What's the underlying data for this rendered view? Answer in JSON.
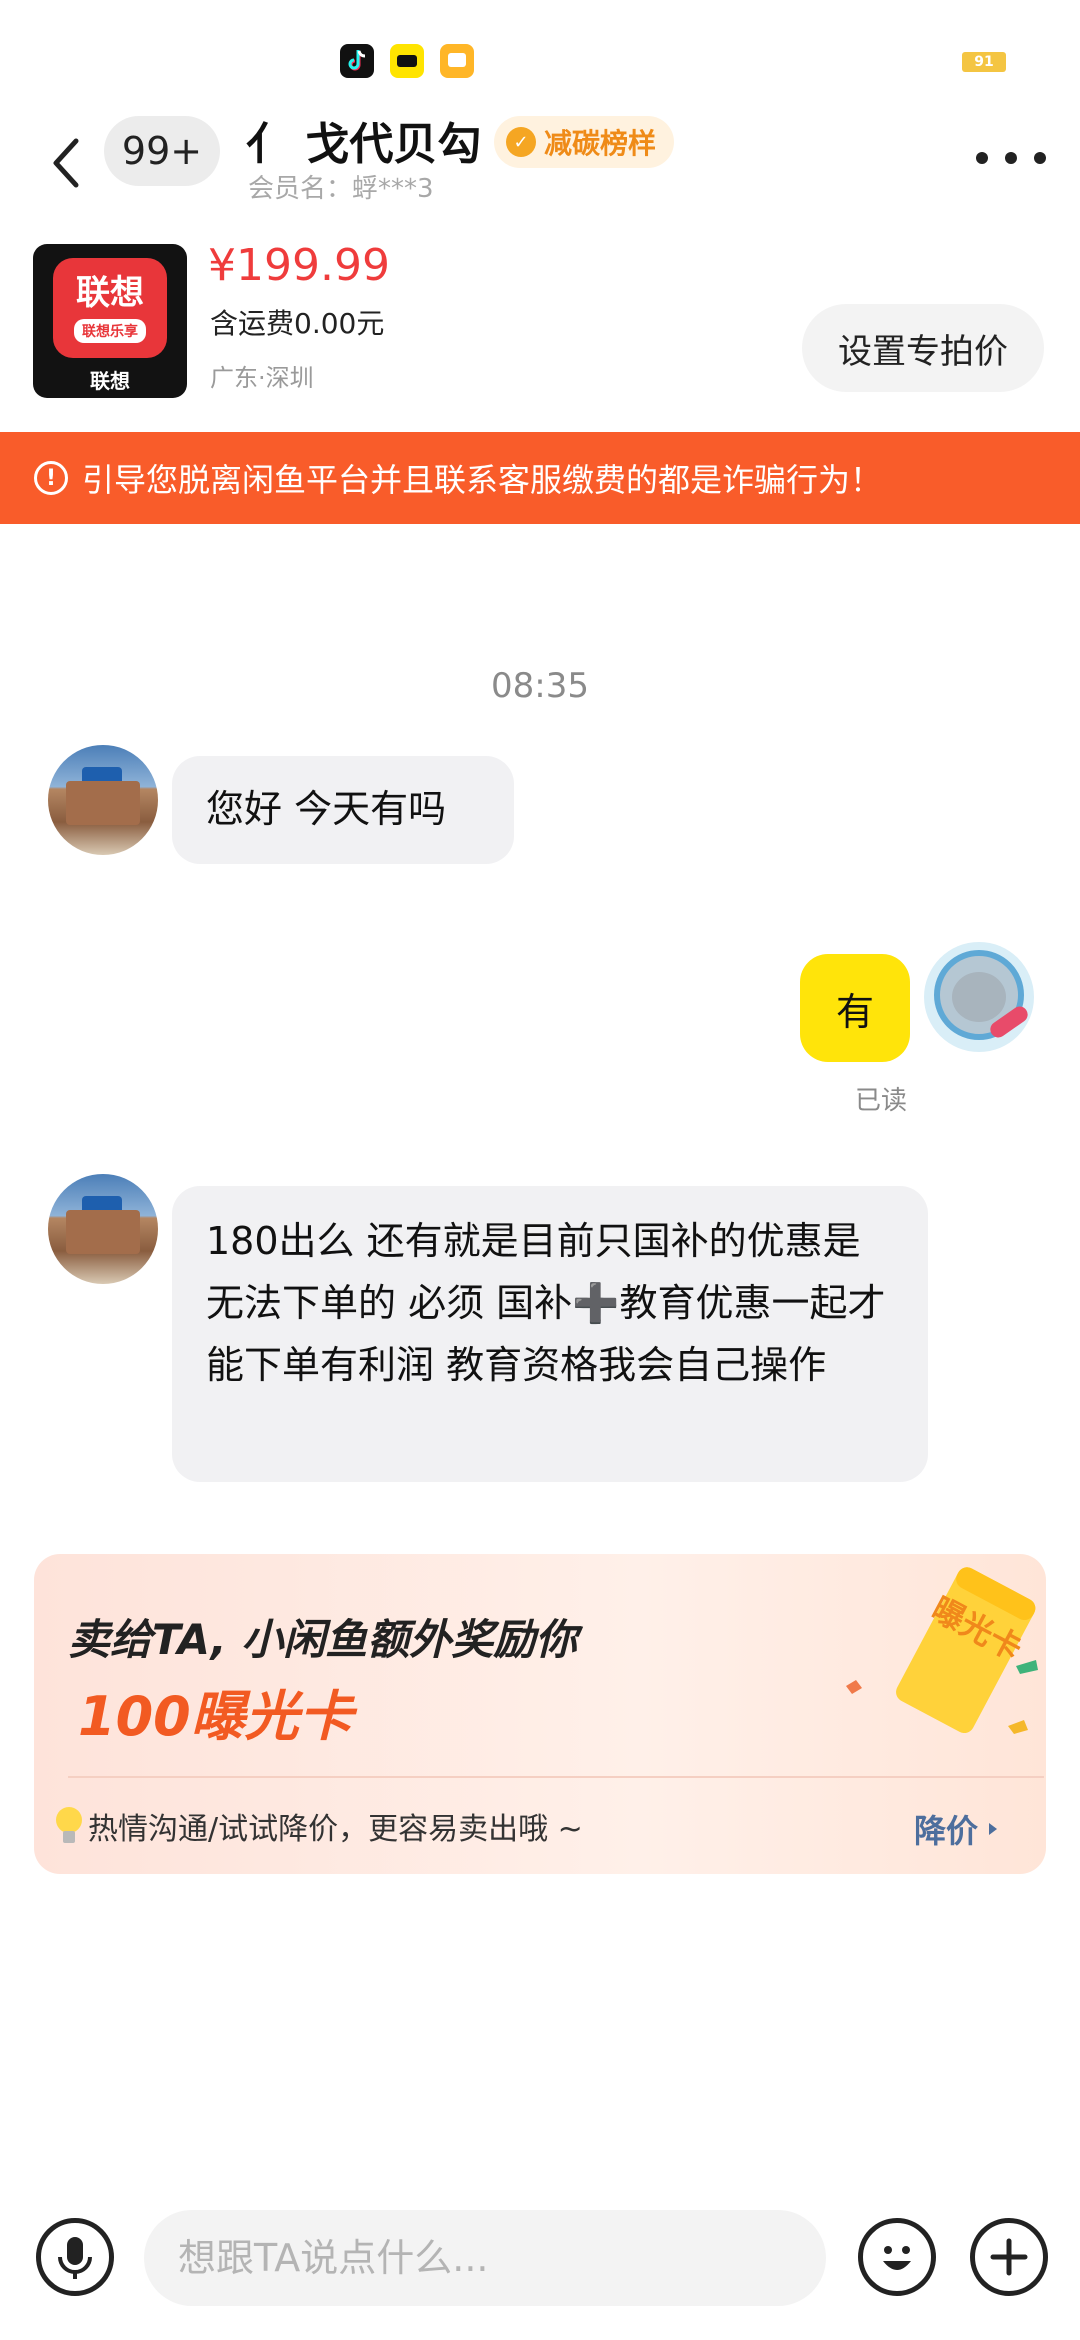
{
  "status_bar": {
    "icons": [
      "tiktok-icon",
      "app-badge-icon",
      "message-app-icon"
    ],
    "battery": "91"
  },
  "header": {
    "back_icon": "chevron-left-icon",
    "unread_count": "99+",
    "title": "亻 戈代贝勾",
    "badge_label": "减碳榜样",
    "member_label": "会员名：蜉***3",
    "more_icon": "more-dots-icon"
  },
  "product": {
    "thumb_logo": "联想",
    "thumb_sub": "联想乐享",
    "thumb_brand": "联想",
    "price": "¥199.99",
    "shipping": "含运费0.00元",
    "location": "广东·深圳",
    "special_price_button": "设置专拍价"
  },
  "warning": {
    "text": "引导您脱离闲鱼平台并且联系客服缴费的都是诈骗行为！",
    "icon": "alert-circle-icon",
    "color": "#f95c2a"
  },
  "chat": {
    "timestamp": "08:35",
    "messages": [
      {
        "from": "other",
        "text": "您好 今天有吗"
      },
      {
        "from": "self",
        "text": "有",
        "status": "已读"
      },
      {
        "from": "other",
        "text": "180出么 还有就是目前只国补的优惠是无法下单的 必须 国补➕教育优惠一起才能下单有利润 教育资格我会自己操作"
      }
    ]
  },
  "promo": {
    "title": "卖给TA, 小闲鱼额外奖励你",
    "reward": "100曝光卡",
    "tip": "热情沟通/试试降价，更容易卖出哦 ~",
    "link_label": "降价",
    "ticket_text": "曝光卡"
  },
  "input_bar": {
    "placeholder": "想跟TA说点什么...",
    "mic_icon": "microphone-icon",
    "emoji_icon": "emoji-icon",
    "plus_icon": "plus-icon"
  },
  "colors": {
    "accent_yellow": "#ffe40a",
    "price_red": "#ef3c3c",
    "warning_orange": "#f95c2a",
    "link_blue": "#4d6e9d"
  }
}
